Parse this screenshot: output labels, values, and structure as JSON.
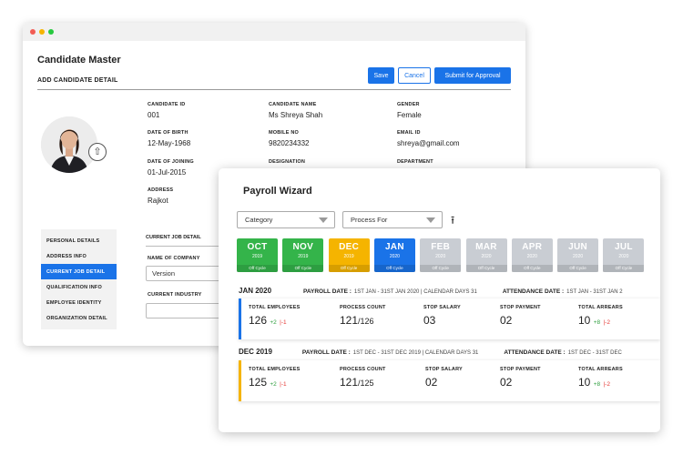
{
  "candidate_master": {
    "title": "Candidate Master",
    "subtitle": "ADD CANDIDATE DETAIL",
    "buttons": {
      "save": "Save",
      "cancel": "Cancel",
      "submit": "Submit for Approval"
    },
    "fields": [
      {
        "label": "CANDIDATE ID",
        "value": "001"
      },
      {
        "label": "CANDIDATE NAME",
        "value": "Ms Shreya Shah"
      },
      {
        "label": "GENDER",
        "value": "Female"
      },
      {
        "label": "DATE OF BIRTH",
        "value": "12-May-1968"
      },
      {
        "label": "MOBILE NO",
        "value": "9820234332"
      },
      {
        "label": "EMAIL ID",
        "value": "shreya@gmail.com"
      },
      {
        "label": "DATE OF JOINING",
        "value": "01-Jul-2015"
      },
      {
        "label": "DESIGNATION",
        "value": ""
      },
      {
        "label": "DEPARTMENT",
        "value": ""
      },
      {
        "label": "ADDRESS",
        "value": "Rajkot"
      }
    ],
    "sidenav": [
      "PERSONAL DETAILS",
      "ADDRESS INFO",
      "CURRENT JOB DETAIL",
      "QUALIFICATION INFO",
      "EMPLOYEE IDENTITY",
      "ORGANIZATION DETAIL"
    ],
    "current_job": {
      "heading": "CURRENT JOB DETAIL",
      "company_label": "NAME OF COMPANY",
      "company_value": "Version",
      "industry_label": "CURRENT INDUSTRY",
      "industry_value": ""
    }
  },
  "payroll": {
    "title": "Payroll Wizard",
    "category_placeholder": "Category",
    "process_placeholder": "Process For",
    "months": [
      {
        "m": "OCT",
        "y": "2019",
        "tag": "Off Cycle",
        "color": "#34b44a"
      },
      {
        "m": "NOV",
        "y": "2019",
        "tag": "Off Cycle",
        "color": "#34b44a"
      },
      {
        "m": "DEC",
        "y": "2019",
        "tag": "Off Cycle",
        "color": "#f5b400"
      },
      {
        "m": "JAN",
        "y": "2020",
        "tag": "Off Cycle",
        "color": "#1a73e8"
      },
      {
        "m": "FEB",
        "y": "2020",
        "tag": "Off Cycle",
        "color": "#c9cdd3"
      },
      {
        "m": "MAR",
        "y": "2020",
        "tag": "Off Cycle",
        "color": "#c9cdd3"
      },
      {
        "m": "APR",
        "y": "2020",
        "tag": "Off Cycle",
        "color": "#c9cdd3"
      },
      {
        "m": "JUN",
        "y": "2020",
        "tag": "Off Cycle",
        "color": "#c9cdd3"
      },
      {
        "m": "JUL",
        "y": "2020",
        "tag": "Off Cycle",
        "color": "#c9cdd3"
      }
    ],
    "sections": [
      {
        "name": "JAN 2020",
        "payroll_label": "PAYROLL DATE :",
        "payroll_value": "1ST JAN - 31ST JAN 2020 | CALENDAR DAYS 31",
        "attendance_label": "ATTENDANCE DATE :",
        "attendance_value": "1ST JAN - 31ST JAN 2",
        "accent": "#1a73e8",
        "stats": {
          "employees": {
            "label": "TOTAL EMPLOYEES",
            "value": "126",
            "up": "+2",
            "down": "|-1"
          },
          "process": {
            "label": "PROCESS COUNT",
            "value": "121",
            "total": "/126"
          },
          "stop_salary": {
            "label": "STOP SALARY",
            "value": "03"
          },
          "stop_payment": {
            "label": "STOP PAYMENT",
            "value": "02"
          },
          "arrears": {
            "label": "TOTAL ARREARS",
            "value": "10",
            "up": "+8",
            "down": "|-2"
          }
        }
      },
      {
        "name": "DEC 2019",
        "payroll_label": "PAYROLL DATE :",
        "payroll_value": "1ST DEC - 31ST DEC 2019 | CALENDAR DAYS 31",
        "attendance_label": "ATTENDANCE DATE :",
        "attendance_value": "1ST DEC - 31ST DEC",
        "accent": "#f5b400",
        "stats": {
          "employees": {
            "label": "TOTAL EMPLOYEES",
            "value": "125",
            "up": "+2",
            "down": "|-1"
          },
          "process": {
            "label": "PROCESS COUNT",
            "value": "121",
            "total": "/125"
          },
          "stop_salary": {
            "label": "STOP SALARY",
            "value": "02"
          },
          "stop_payment": {
            "label": "STOP PAYMENT",
            "value": "02"
          },
          "arrears": {
            "label": "TOTAL ARREARS",
            "value": "10",
            "up": "+8",
            "down": "|-2"
          }
        }
      }
    ]
  }
}
